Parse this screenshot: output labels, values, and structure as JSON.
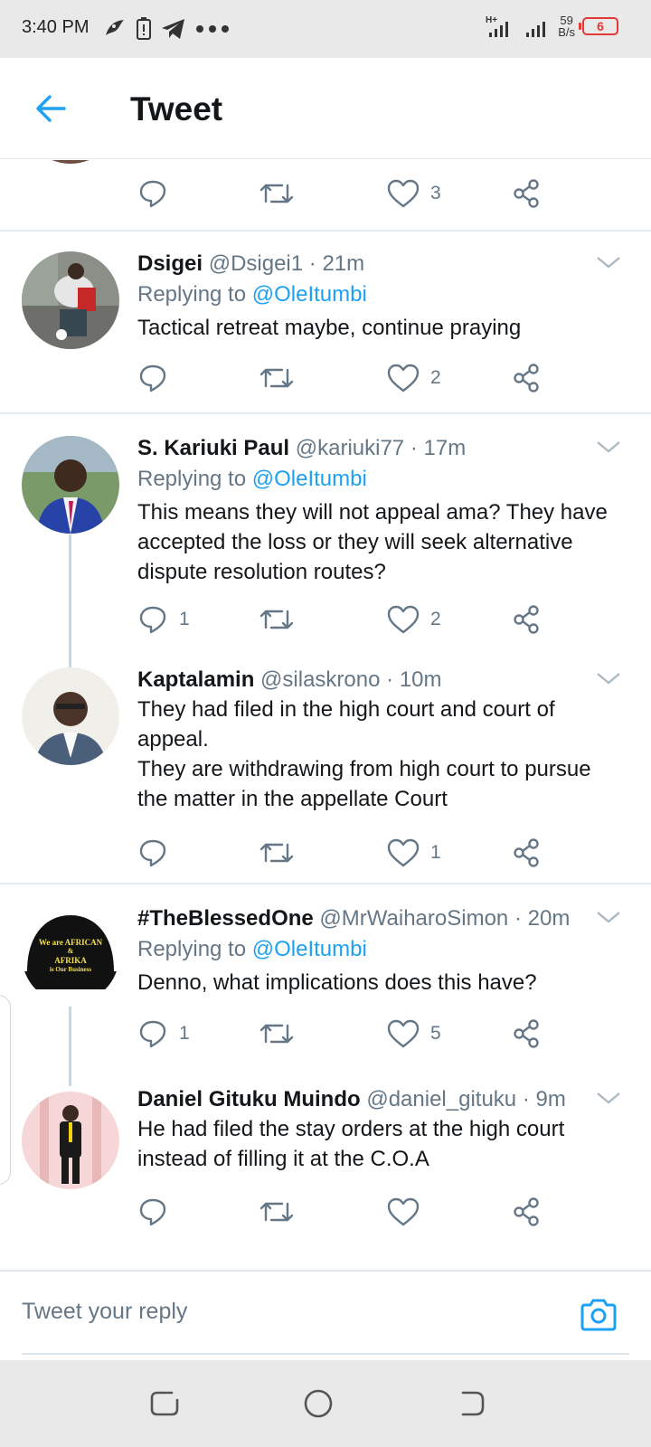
{
  "status_bar": {
    "time": "3:40 PM",
    "network": "H+",
    "speed_value": "59",
    "speed_unit": "B/s",
    "battery": "6"
  },
  "header": {
    "title": "Tweet"
  },
  "top_partial": {
    "like_count": "3"
  },
  "tweets": [
    {
      "name": "Dsigei",
      "handle": "@Dsigei1",
      "time": "21m",
      "replying_prefix": "Replying to ",
      "replying_to": "@OleItumbi",
      "text": "Tactical retreat maybe, continue praying",
      "reply_count": "",
      "retweet_count": "",
      "like_count": "2"
    },
    {
      "name": "S. Kariuki Paul",
      "handle": "@kariuki77",
      "time": "17m",
      "replying_prefix": "Replying to ",
      "replying_to": "@OleItumbi",
      "text": "This means they will not appeal ama? They have accepted the loss or they will seek alternative dispute resolution routes?",
      "reply_count": "1",
      "retweet_count": "",
      "like_count": "2"
    },
    {
      "name": "Kaptalamin",
      "handle": "@silaskrono",
      "time": "10m",
      "text_line1": "They had filed in the high court and court of appeal.",
      "text_line2": "They are withdrawing from high court to pursue the matter in the appellate Court",
      "reply_count": "",
      "retweet_count": "",
      "like_count": "1"
    },
    {
      "name": "#TheBlessedOne",
      "handle": "@MrWaiharoSimon",
      "time": "20m",
      "replying_prefix": "Replying to ",
      "replying_to": "@OleItumbi",
      "text": "Denno, what implications does this have?",
      "reply_count": "1",
      "retweet_count": "",
      "like_count": "5",
      "avatar_text": [
        "We are AFRICAN",
        "&",
        "AFRIKA",
        "is Our Business"
      ]
    },
    {
      "name": "Daniel Gituku Muindo",
      "handle": "@daniel_gituku",
      "time": "9m",
      "text": "He had filed the stay orders at the high court instead of filling it at the C.O.A",
      "reply_count": "",
      "retweet_count": "",
      "like_count": ""
    }
  ],
  "reply_bar": {
    "placeholder": "Tweet your reply"
  },
  "colors": {
    "accent": "#1da1f2",
    "text": "#14171a",
    "secondary": "#657786",
    "divider": "#e6ecf0",
    "battery": "#e53935"
  }
}
